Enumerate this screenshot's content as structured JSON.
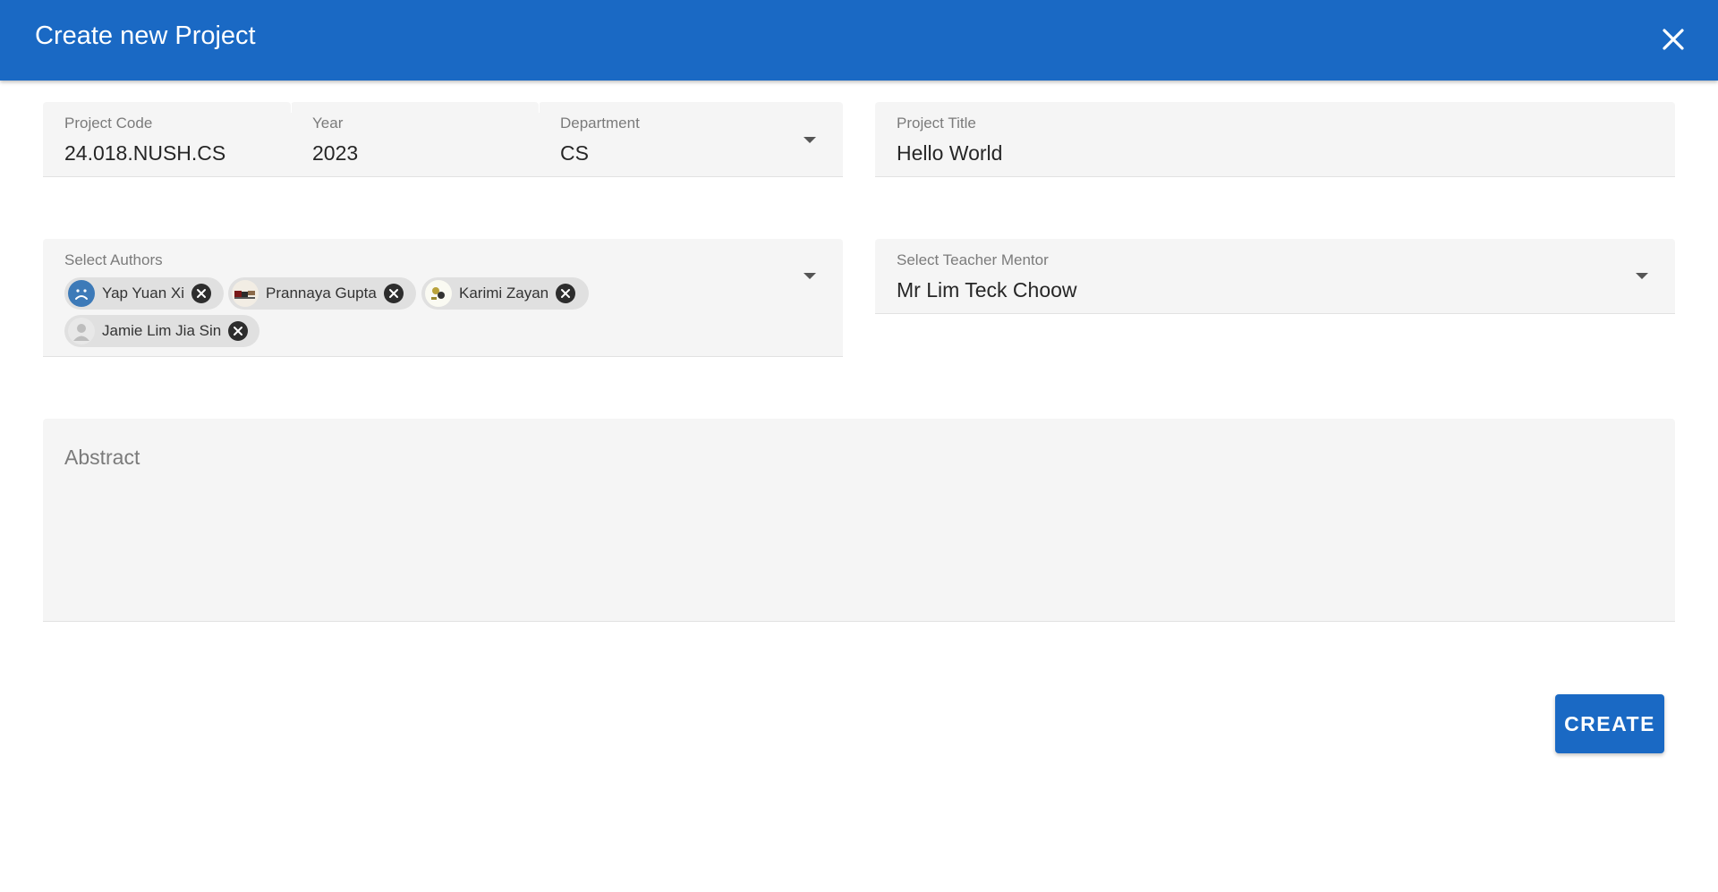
{
  "header": {
    "title": "Create new Project"
  },
  "project_code": {
    "label": "Project Code",
    "value": "24.018.NUSH.CS"
  },
  "year": {
    "label": "Year",
    "value": "2023"
  },
  "department": {
    "label": "Department",
    "value": "CS"
  },
  "project_title": {
    "label": "Project Title",
    "value": "Hello World"
  },
  "authors": {
    "label": "Select Authors",
    "chips": [
      {
        "name": "Yap Yuan Xi",
        "avatar": "sad-face-icon"
      },
      {
        "name": "Prannaya Gupta",
        "avatar": "photo-avatar"
      },
      {
        "name": "Karimi Zayan",
        "avatar": "photo-avatar"
      },
      {
        "name": "Jamie Lim Jia Sin",
        "avatar": "person-icon"
      }
    ]
  },
  "mentor": {
    "label": "Select Teacher Mentor",
    "value": "Mr Lim Teck Choow"
  },
  "abstract": {
    "placeholder": "Abstract"
  },
  "actions": {
    "create_label": "CREATE"
  },
  "colors": {
    "primary": "#1a69c4",
    "field_bg": "#f5f5f5",
    "chip_bg": "#e0e0e0"
  }
}
